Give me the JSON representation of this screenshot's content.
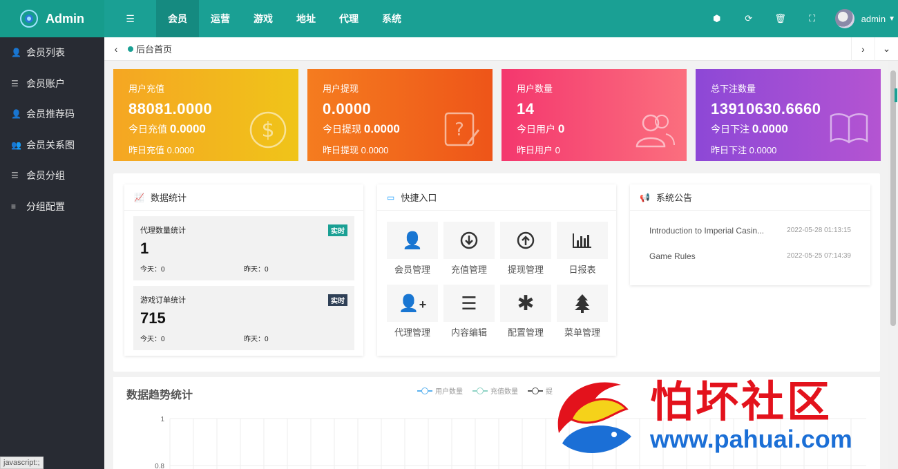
{
  "app": {
    "logo_text": "Admin"
  },
  "topbar": {
    "menu_icon": "list-icon",
    "nav": [
      {
        "label": "会员",
        "active": true
      },
      {
        "label": "运营"
      },
      {
        "label": "游戏"
      },
      {
        "label": "地址"
      },
      {
        "label": "代理"
      },
      {
        "label": "系统"
      }
    ],
    "right_icons": [
      "cube-icon",
      "refresh-icon",
      "trash-icon",
      "fullscreen-icon"
    ],
    "user": "admin"
  },
  "sidebar": {
    "items": [
      {
        "label": "会员列表",
        "icon": "user-icon"
      },
      {
        "label": "会员账户",
        "icon": "list-icon"
      },
      {
        "label": "会员推荐码",
        "icon": "user-plus-icon"
      },
      {
        "label": "会员关系图",
        "icon": "users-icon"
      },
      {
        "label": "会员分组",
        "icon": "list-icon"
      },
      {
        "label": "分组配置",
        "icon": "align-icon"
      }
    ]
  },
  "tabs": {
    "current": "后台首页"
  },
  "cards": [
    {
      "title": "用户充值",
      "value": "88081.0000",
      "today_label": "今日充值",
      "today_value": "0.0000",
      "yesterday_label": "昨日充值",
      "yesterday_value": "0.0000",
      "icon": "dollar-icon"
    },
    {
      "title": "用户提现",
      "value": "0.0000",
      "today_label": "今日提现",
      "today_value": "0.0000",
      "yesterday_label": "昨日提现",
      "yesterday_value": "0.0000",
      "icon": "question-edit-icon"
    },
    {
      "title": "用户数量",
      "value": "14",
      "today_label": "今日用户",
      "today_value": "0",
      "yesterday_label": "昨日用户",
      "yesterday_value": "0",
      "icon": "users-icon"
    },
    {
      "title": "总下注数量",
      "value": "13910630.6660",
      "today_label": "今日下注",
      "today_value": "0.0000",
      "yesterday_label": "昨日下注",
      "yesterday_value": "0.0000",
      "icon": "book-icon"
    }
  ],
  "stats_panel": {
    "title": "数据统计",
    "items": [
      {
        "name": "代理数量统计",
        "badge": "实时",
        "badge_color": "#1aa094",
        "value": "1",
        "today": "今天：0",
        "yesterday": "昨天：0"
      },
      {
        "name": "游戏订单统计",
        "badge": "实时",
        "badge_color": "#2f4056",
        "value": "715",
        "today": "今天：0",
        "yesterday": "昨天：0"
      }
    ]
  },
  "quick_panel": {
    "title": "快捷入口",
    "items": [
      {
        "label": "会员管理",
        "icon": "user-icon"
      },
      {
        "label": "充值管理",
        "icon": "arrow-down-circle-icon"
      },
      {
        "label": "提现管理",
        "icon": "arrow-up-circle-icon"
      },
      {
        "label": "日报表",
        "icon": "bar-chart-icon"
      },
      {
        "label": "代理管理",
        "icon": "user-plus-icon"
      },
      {
        "label": "内容编辑",
        "icon": "lines-icon"
      },
      {
        "label": "配置管理",
        "icon": "asterisk-icon"
      },
      {
        "label": "菜单管理",
        "icon": "tree-icon"
      }
    ]
  },
  "notice_panel": {
    "title": "系统公告",
    "items": [
      {
        "title": "Introduction to Imperial Casin...",
        "date": "2022-05-28 01:13:15"
      },
      {
        "title": "Game Rules",
        "date": "2022-05-25 07:14:39"
      }
    ]
  },
  "trend": {
    "title": "数据趋势统计",
    "legend": [
      {
        "name": "用户数量",
        "color": "#5ab1ef"
      },
      {
        "name": "充值数量",
        "color": "#8fd3c5"
      },
      {
        "name": "提",
        "color": "#555555"
      }
    ]
  },
  "chart_data": {
    "type": "line",
    "title": "数据趋势统计",
    "y_ticks_visible": [
      "1",
      "0.8"
    ],
    "series": [
      {
        "name": "用户数量",
        "values": []
      },
      {
        "name": "充值数量",
        "values": []
      }
    ]
  },
  "watermark": {
    "cn": "怕坏社区",
    "url": "www.pahuai.com"
  },
  "statusbar": "javascript:;"
}
